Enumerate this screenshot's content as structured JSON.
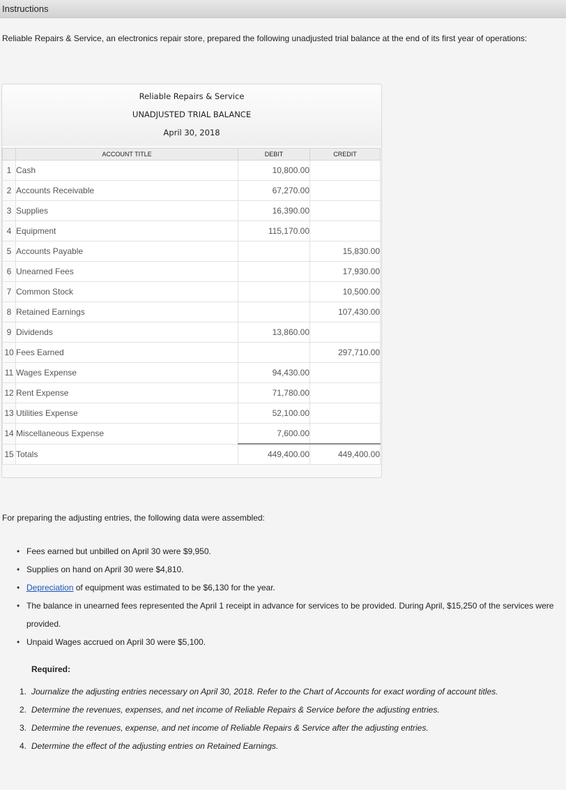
{
  "header": {
    "title": "Instructions"
  },
  "intro": "Reliable Repairs & Service, an electronics repair store, prepared the following unadjusted trial balance at the end of its first year of operations:",
  "trial_balance": {
    "company": "Reliable Repairs & Service",
    "title": "UNADJUSTED TRIAL BALANCE",
    "date": "April 30, 2018",
    "columns": {
      "account": "ACCOUNT TITLE",
      "debit": "DEBIT",
      "credit": "CREDIT"
    },
    "rows": [
      {
        "num": "1",
        "account": "Cash",
        "debit": "10,800.00",
        "credit": ""
      },
      {
        "num": "2",
        "account": "Accounts Receivable",
        "debit": "67,270.00",
        "credit": ""
      },
      {
        "num": "3",
        "account": "Supplies",
        "debit": "16,390.00",
        "credit": ""
      },
      {
        "num": "4",
        "account": "Equipment",
        "debit": "115,170.00",
        "credit": ""
      },
      {
        "num": "5",
        "account": "Accounts Payable",
        "debit": "",
        "credit": "15,830.00"
      },
      {
        "num": "6",
        "account": "Unearned Fees",
        "debit": "",
        "credit": "17,930.00"
      },
      {
        "num": "7",
        "account": "Common Stock",
        "debit": "",
        "credit": "10,500.00"
      },
      {
        "num": "8",
        "account": "Retained Earnings",
        "debit": "",
        "credit": "107,430.00"
      },
      {
        "num": "9",
        "account": "Dividends",
        "debit": "13,860.00",
        "credit": ""
      },
      {
        "num": "10",
        "account": "Fees Earned",
        "debit": "",
        "credit": "297,710.00"
      },
      {
        "num": "11",
        "account": "Wages Expense",
        "debit": "94,430.00",
        "credit": ""
      },
      {
        "num": "12",
        "account": "Rent Expense",
        "debit": "71,780.00",
        "credit": ""
      },
      {
        "num": "13",
        "account": "Utilities Expense",
        "debit": "52,100.00",
        "credit": ""
      },
      {
        "num": "14",
        "account": "Miscellaneous Expense",
        "debit": "7,600.00",
        "credit": ""
      },
      {
        "num": "15",
        "account": "Totals",
        "debit": "449,400.00",
        "credit": "449,400.00"
      }
    ]
  },
  "assembled_text": "For preparing the adjusting entries, the following data were assembled:",
  "data_items": {
    "item1": "Fees earned but unbilled on April 30 were $9,950.",
    "item2": "Supplies on hand on April 30 were $4,810.",
    "item3_link": "Depreciation",
    "item3_rest": " of equipment was estimated to be $6,130 for the year.",
    "item4": "The balance in unearned fees represented the April 1 receipt in advance for services to be provided. During April, $15,250 of the services were provided.",
    "item5": "Unpaid Wages accrued on April 30 were $5,100."
  },
  "required": {
    "heading": "Required:",
    "items": [
      {
        "n": "1.",
        "text": "Journalize the adjusting entries necessary on April 30, 2018. Refer to the Chart of Accounts for exact wording of account titles."
      },
      {
        "n": "2.",
        "text": "Determine the revenues, expenses, and net income of Reliable Repairs & Service before the adjusting entries."
      },
      {
        "n": "3.",
        "text": "Determine the revenues, expense, and net income of Reliable Repairs & Service after the adjusting entries."
      },
      {
        "n": "4.",
        "text": "Determine the effect of the adjusting entries on Retained Earnings."
      }
    ]
  }
}
